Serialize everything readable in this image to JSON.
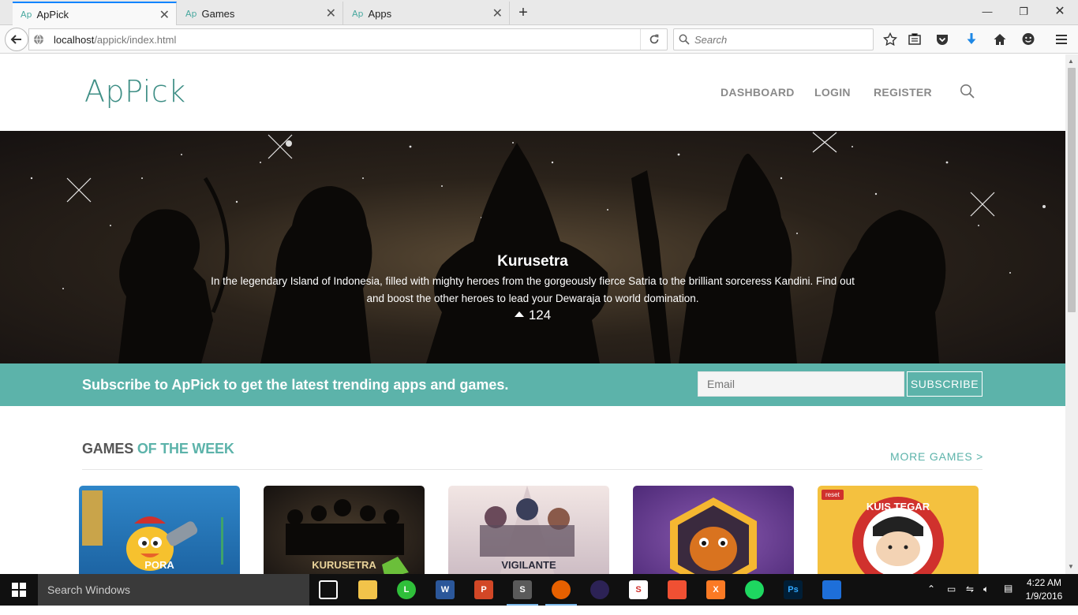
{
  "browser": {
    "tabs": [
      {
        "favicon": "Ap",
        "title": "ApPick",
        "active": true
      },
      {
        "favicon": "Ap",
        "title": "Games",
        "active": false
      },
      {
        "favicon": "Ap",
        "title": "Apps",
        "active": false
      }
    ],
    "url_host": "localhost",
    "url_path": "/appick/index.html",
    "search_placeholder": "Search"
  },
  "site": {
    "logo": "ApPick",
    "nav": [
      "DASHBOARD",
      "LOGIN",
      "REGISTER"
    ]
  },
  "hero": {
    "title": "Kurusetra",
    "description": "In the legendary Island of Indonesia, filled with mighty heroes from the gorgeously fierce Satria to the brilliant sorceress Kandini. Find out and boost the other heroes to lead your Dewaraja to world domination.",
    "votes": "124"
  },
  "subscribe": {
    "text": "Subscribe to ApPick to get the latest trending apps and games.",
    "email_placeholder": "Email",
    "button": "SUBSCRIBE"
  },
  "games_section": {
    "title_main": "GAMES",
    "title_accent": "OF THE WEEK",
    "more_link": "MORE GAMES >",
    "cards": [
      {
        "caption": "PORA"
      },
      {
        "caption": "KURUSETRA"
      },
      {
        "caption": "VIGILANTE"
      },
      {
        "caption": ""
      },
      {
        "caption": "KUIS TEGAR",
        "badge": "reset"
      }
    ]
  },
  "taskbar": {
    "search_placeholder": "Search Windows",
    "time": "4:22 AM",
    "date": "1/9/2016"
  }
}
